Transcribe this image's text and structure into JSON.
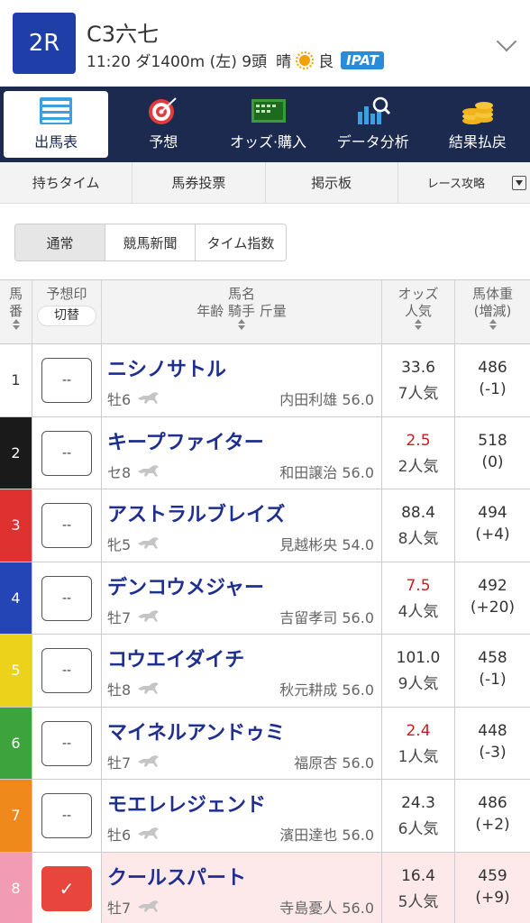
{
  "race": {
    "number": "2R",
    "name": "C3六七",
    "info_time_course": "11:20 ダ1400m (左) 9頭",
    "weather": "晴",
    "weather_icon": "sun-icon",
    "track_condition": "良",
    "ipat_label": "IPAT"
  },
  "main_nav": {
    "items": [
      {
        "label": "出馬表",
        "icon": "entry-table-icon",
        "active": true
      },
      {
        "label": "予想",
        "icon": "target-icon",
        "active": false
      },
      {
        "label": "オッズ·購入",
        "icon": "betting-board-icon",
        "active": false
      },
      {
        "label": "データ分析",
        "icon": "chart-magnifier-icon",
        "active": false
      },
      {
        "label": "結果払戻",
        "icon": "coins-icon",
        "active": false
      }
    ]
  },
  "sub_nav": {
    "items": [
      "持ちタイム",
      "馬券投票",
      "掲示板",
      "レース攻略"
    ]
  },
  "segment": {
    "items": [
      "通常",
      "競馬新聞",
      "タイム指数"
    ],
    "active": 0
  },
  "table": {
    "headers": {
      "num": "馬番",
      "mark": "予想印",
      "mark_toggle": "切替",
      "name_top": "馬名",
      "name_bottom": "年齢 騎手 斤量",
      "odds_top": "オッズ",
      "odds_bottom": "人気",
      "weight_top": "馬体重",
      "weight_bottom": "(増減)"
    },
    "rows": [
      {
        "num": "1",
        "color": "#ffffff",
        "text_color": "#333333",
        "mark": "--",
        "checked": false,
        "name": "ニシノサトル",
        "age": "牡6",
        "jockey": "内田利雄 56.0",
        "odds": "33.6",
        "fav": false,
        "popularity": "7人気",
        "weight": "486",
        "diff": "(-1)"
      },
      {
        "num": "2",
        "color": "#1a1a1a",
        "text_color": "#ffffff",
        "mark": "--",
        "checked": false,
        "name": "キープファイター",
        "age": "セ8",
        "jockey": "和田譲治 56.0",
        "odds": "2.5",
        "fav": true,
        "popularity": "2人気",
        "weight": "518",
        "diff": "(0)"
      },
      {
        "num": "3",
        "color": "#e03131",
        "text_color": "#ffffff",
        "mark": "--",
        "checked": false,
        "name": "アストラルブレイズ",
        "age": "牝5",
        "jockey": "見越彬央 54.0",
        "odds": "88.4",
        "fav": false,
        "popularity": "8人気",
        "weight": "494",
        "diff": "(+4)"
      },
      {
        "num": "4",
        "color": "#2445b5",
        "text_color": "#ffffff",
        "mark": "--",
        "checked": false,
        "name": "デンコウメジャー",
        "age": "牡7",
        "jockey": "吉留孝司 56.0",
        "odds": "7.5",
        "fav": true,
        "popularity": "4人気",
        "weight": "492",
        "diff": "(+20)"
      },
      {
        "num": "5",
        "color": "#ecd21a",
        "text_color": "#ffffff",
        "mark": "--",
        "checked": false,
        "name": "コウエイダイチ",
        "age": "牡8",
        "jockey": "秋元耕成 56.0",
        "odds": "101.0",
        "fav": false,
        "popularity": "9人気",
        "weight": "458",
        "diff": "(-1)"
      },
      {
        "num": "6",
        "color": "#3da43d",
        "text_color": "#ffffff",
        "mark": "--",
        "checked": false,
        "name": "マイネルアンドゥミ",
        "age": "牡7",
        "jockey": "福原杏 56.0",
        "odds": "2.4",
        "fav": true,
        "popularity": "1人気",
        "weight": "448",
        "diff": "(-3)"
      },
      {
        "num": "7",
        "color": "#f0891c",
        "text_color": "#ffffff",
        "mark": "--",
        "checked": false,
        "name": "モエレレジェンド",
        "age": "牡6",
        "jockey": "濱田達也 56.0",
        "odds": "24.3",
        "fav": false,
        "popularity": "6人気",
        "weight": "486",
        "diff": "(+2)"
      },
      {
        "num": "8",
        "color": "#f19bb5",
        "text_color": "#ffffff",
        "mark": "✓",
        "checked": true,
        "name": "クールスパート",
        "age": "牡7",
        "jockey": "寺島憂人 56.0",
        "odds": "16.4",
        "fav": false,
        "popularity": "5人気",
        "weight": "459",
        "diff": "(+9)"
      }
    ]
  }
}
